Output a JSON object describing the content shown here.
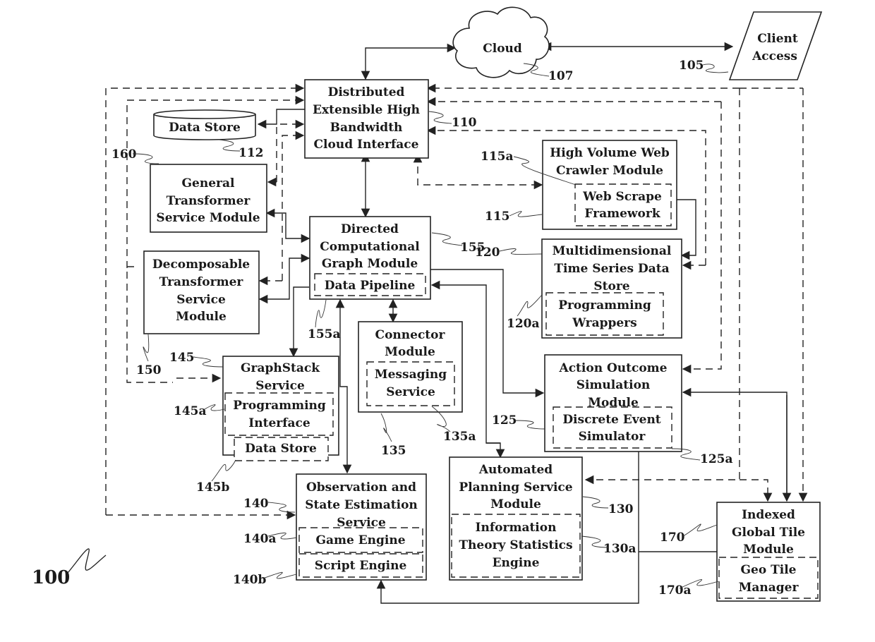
{
  "figure": {
    "number": "100"
  },
  "nodes": {
    "cloud": {
      "ref": "107",
      "lines": [
        "Cloud"
      ]
    },
    "client_access": {
      "ref": "105",
      "lines": [
        "Client",
        "Access"
      ]
    },
    "cloud_interface": {
      "ref": "110",
      "lines": [
        "Distributed",
        "Extensible High",
        "Bandwidth",
        "Cloud Interface"
      ]
    },
    "data_store": {
      "ref": "112",
      "lines": [
        "Data Store"
      ]
    },
    "general_transformer": {
      "ref": "160",
      "lines": [
        "General",
        "Transformer",
        "Service Module"
      ]
    },
    "decomposable_transformer": {
      "ref": "150",
      "lines": [
        "Decomposable",
        "Transformer",
        "Service",
        "Module"
      ]
    },
    "web_crawler": {
      "ref": "115",
      "lines": [
        "High Volume Web",
        "Crawler Module"
      ],
      "sub": {
        "ref": "115a",
        "lines": [
          "Web Scrape",
          "Framework"
        ]
      }
    },
    "dcg_module": {
      "ref": "155",
      "lines": [
        "Directed",
        "Computational",
        "Graph Module"
      ],
      "sub": {
        "ref": "155a",
        "lines": [
          "Data Pipeline"
        ]
      }
    },
    "time_series": {
      "ref": "120",
      "lines": [
        "Multidimensional",
        "Time Series Data",
        "Store"
      ],
      "sub": {
        "ref": "120a",
        "lines": [
          "Programming",
          "Wrappers"
        ]
      }
    },
    "connector": {
      "ref": "135",
      "lines": [
        "Connector",
        "Module"
      ],
      "sub": {
        "ref": "135a",
        "lines": [
          "Messaging",
          "Service"
        ]
      }
    },
    "graphstack": {
      "ref": "145",
      "lines": [
        "GraphStack",
        "Service"
      ],
      "sub": {
        "ref": "145a",
        "lines": [
          "Programming",
          "Interface"
        ]
      },
      "sub2": {
        "ref": "145b",
        "lines": [
          "Data Store"
        ]
      }
    },
    "action_outcome": {
      "ref": "125",
      "lines": [
        "Action Outcome",
        "Simulation",
        "Module"
      ],
      "sub": {
        "ref": "125a",
        "lines": [
          "Discrete Event",
          "Simulator"
        ]
      }
    },
    "observation": {
      "ref": "140",
      "lines": [
        "Observation and",
        "State Estimation",
        "Service"
      ],
      "sub": {
        "ref": "140a",
        "lines": [
          "Game Engine"
        ]
      },
      "sub2": {
        "ref": "140b",
        "lines": [
          "Script Engine"
        ]
      }
    },
    "planning": {
      "ref": "130",
      "lines": [
        "Automated",
        "Planning Service",
        "Module"
      ],
      "sub": {
        "ref": "130a",
        "lines": [
          "Information",
          "Theory Statistics",
          "Engine"
        ]
      }
    },
    "tile_module": {
      "ref": "170",
      "lines": [
        "Indexed",
        "Global Tile",
        "Module"
      ],
      "sub": {
        "ref": "170a",
        "lines": [
          "Geo Tile",
          "Manager"
        ]
      }
    }
  }
}
